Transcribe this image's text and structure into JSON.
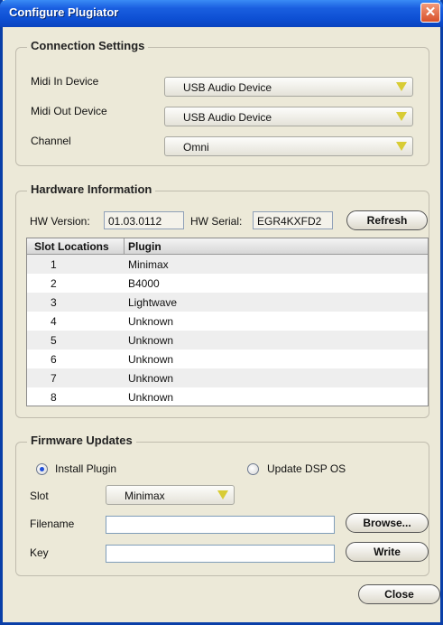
{
  "window": {
    "title": "Configure Plugiator",
    "close_glyph": "✕"
  },
  "connection": {
    "title": "Connection Settings",
    "midi_in_label": "Midi In Device",
    "midi_in_value": "USB Audio Device",
    "midi_out_label": "Midi Out Device",
    "midi_out_value": "USB Audio Device",
    "channel_label": "Channel",
    "channel_value": "Omni"
  },
  "hardware": {
    "title": "Hardware Information",
    "hw_version_label": "HW Version:",
    "hw_version_value": "01.03.0112",
    "hw_serial_label": "HW Serial:",
    "hw_serial_value": "EGR4KXFD2",
    "refresh_label": "Refresh",
    "columns": [
      "Slot Locations",
      "Plugin"
    ],
    "rows": [
      {
        "slot": "1",
        "plugin": "Minimax"
      },
      {
        "slot": "2",
        "plugin": "B4000"
      },
      {
        "slot": "3",
        "plugin": "Lightwave"
      },
      {
        "slot": "4",
        "plugin": "Unknown"
      },
      {
        "slot": "5",
        "plugin": "Unknown"
      },
      {
        "slot": "6",
        "plugin": "Unknown"
      },
      {
        "slot": "7",
        "plugin": "Unknown"
      },
      {
        "slot": "8",
        "plugin": "Unknown"
      }
    ]
  },
  "firmware": {
    "title": "Firmware Updates",
    "install_label": "Install Plugin",
    "update_label": "Update DSP OS",
    "install_selected": true,
    "slot_label": "Slot",
    "slot_value": "Minimax",
    "filename_label": "Filename",
    "filename_value": "",
    "browse_label": "Browse...",
    "key_label": "Key",
    "key_value": "",
    "write_label": "Write"
  },
  "footer": {
    "close_label": "Close"
  },
  "colors": {
    "title_bar": "#0d4fd3",
    "dialog_bg": "#ece9d8",
    "close_red": "#d8512a",
    "combo_arrow": "#d8cc35"
  }
}
